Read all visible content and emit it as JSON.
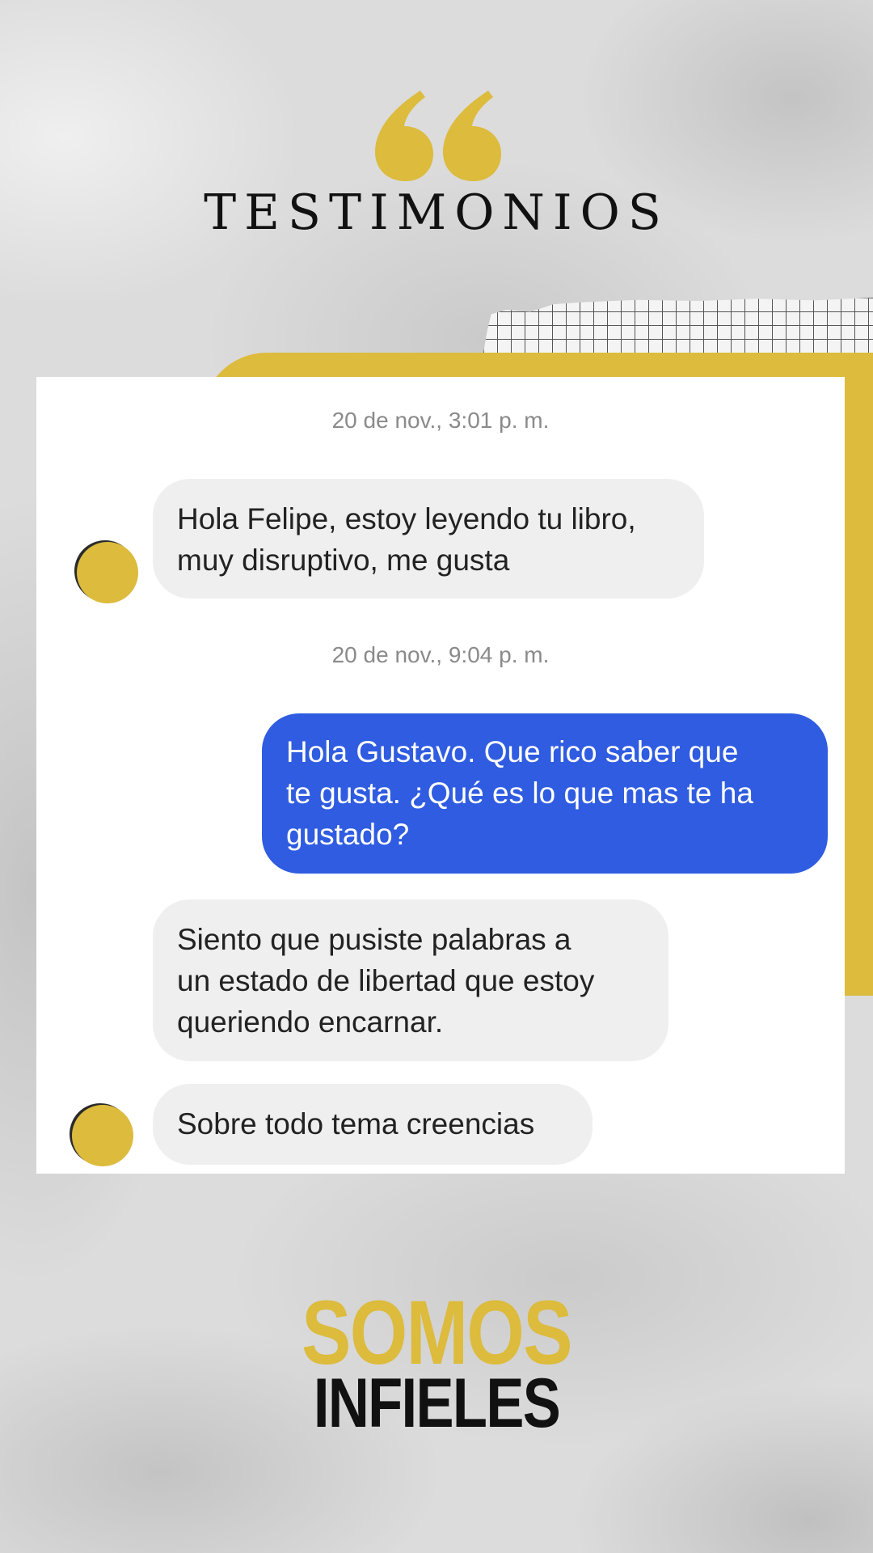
{
  "header": {
    "title": "TESTIMONIOS",
    "icon": "quote-icon"
  },
  "chat": {
    "messages": [
      {
        "type": "timestamp",
        "text": "20 de nov., 3:01 p. m."
      },
      {
        "type": "incoming",
        "text": "Hola Felipe, estoy leyendo tu libro,\nmuy disruptivo, me gusta"
      },
      {
        "type": "timestamp",
        "text": "20 de nov., 9:04 p. m."
      },
      {
        "type": "outgoing",
        "text": "Hola Gustavo. Que rico saber que\nte gusta. ¿Qué es  lo que mas te ha\ngustado?"
      },
      {
        "type": "incoming",
        "text": "Siento que pusiste palabras a\nun estado de libertad que estoy\nqueriendo encarnar."
      },
      {
        "type": "incoming",
        "text": "Sobre todo tema creencias"
      }
    ]
  },
  "brand": {
    "line1": "SOMOS",
    "line2": "INFIELES"
  },
  "colors": {
    "accent": "#dcbb3d",
    "outgoing_bubble": "#2f5ce0",
    "incoming_bubble": "#efefef"
  }
}
